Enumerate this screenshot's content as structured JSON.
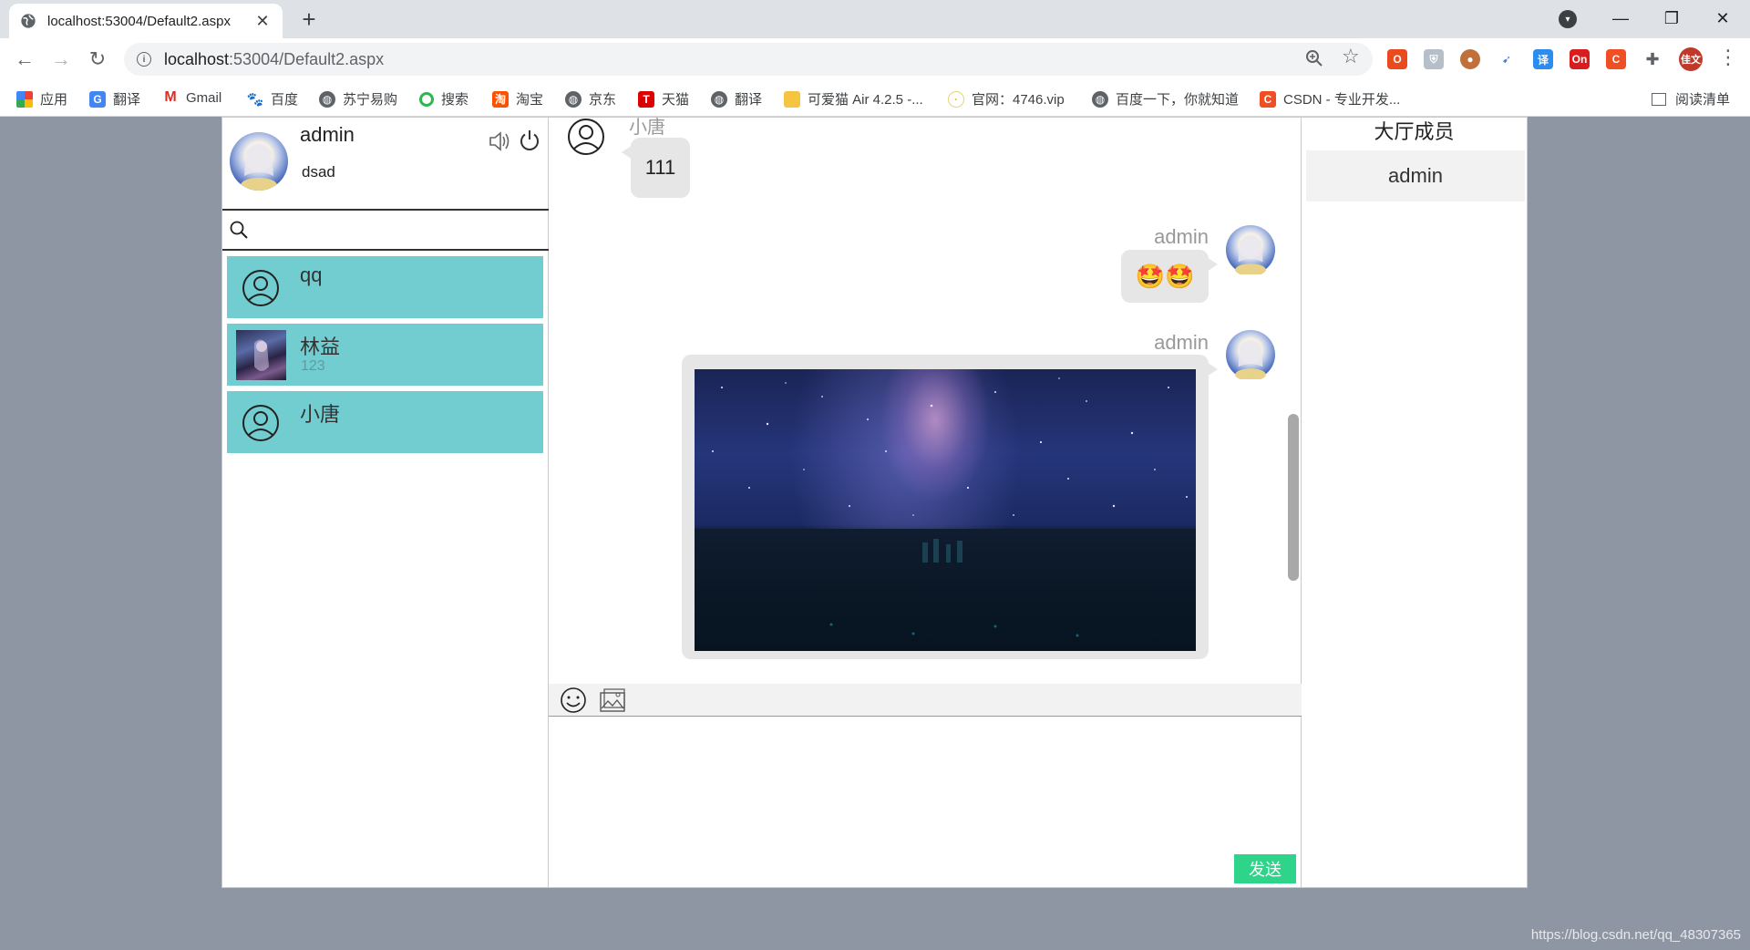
{
  "browser": {
    "tab_title": "localhost:53004/Default2.aspx",
    "close_glyph": "✕",
    "new_tab_glyph": "+",
    "url_host": "localhost",
    "url_rest": ":53004/Default2.aspx",
    "bookmarks": [
      {
        "label": "应用",
        "icon": "apps-icon"
      },
      {
        "label": "翻译",
        "icon": "translate-icon"
      },
      {
        "label": "Gmail",
        "icon": "gmail-icon"
      },
      {
        "label": "百度",
        "icon": "baidu-icon"
      },
      {
        "label": "苏宁易购",
        "icon": "globe-icon"
      },
      {
        "label": "搜索",
        "icon": "search-icon"
      },
      {
        "label": "淘宝",
        "icon": "taobao-icon"
      },
      {
        "label": "京东",
        "icon": "globe-icon"
      },
      {
        "label": "天猫",
        "icon": "tmall-icon"
      },
      {
        "label": "翻译",
        "icon": "globe-icon"
      },
      {
        "label": "可爱猫 Air 4.2.5 -...",
        "icon": "folder-icon"
      },
      {
        "label": "官网：4746.vip",
        "icon": "site-icon"
      },
      {
        "label": "百度一下，你就知道",
        "icon": "globe-icon"
      },
      {
        "label": "CSDN - 专业开发...",
        "icon": "csdn-icon"
      }
    ],
    "reading_list": "阅读清单",
    "profile_initial": "佳文"
  },
  "me": {
    "name": "admin",
    "signature": "dsad"
  },
  "search": {
    "placeholder": ""
  },
  "contacts": [
    {
      "name": "qq",
      "last_message": "",
      "avatar": "default"
    },
    {
      "name": "林益",
      "last_message": "123",
      "avatar": "photo"
    },
    {
      "name": "小唐",
      "last_message": "",
      "avatar": "default"
    }
  ],
  "messages": [
    {
      "sender": "小唐",
      "side": "left",
      "text": "111"
    },
    {
      "sender": "admin",
      "side": "right",
      "text": "🤩🤩"
    },
    {
      "sender": "admin",
      "side": "right",
      "type": "image"
    }
  ],
  "composer": {
    "send_label": "发送"
  },
  "hall": {
    "title": "大厅成员",
    "members": [
      "admin"
    ]
  },
  "watermark": "https://blog.csdn.net/qq_48307365"
}
